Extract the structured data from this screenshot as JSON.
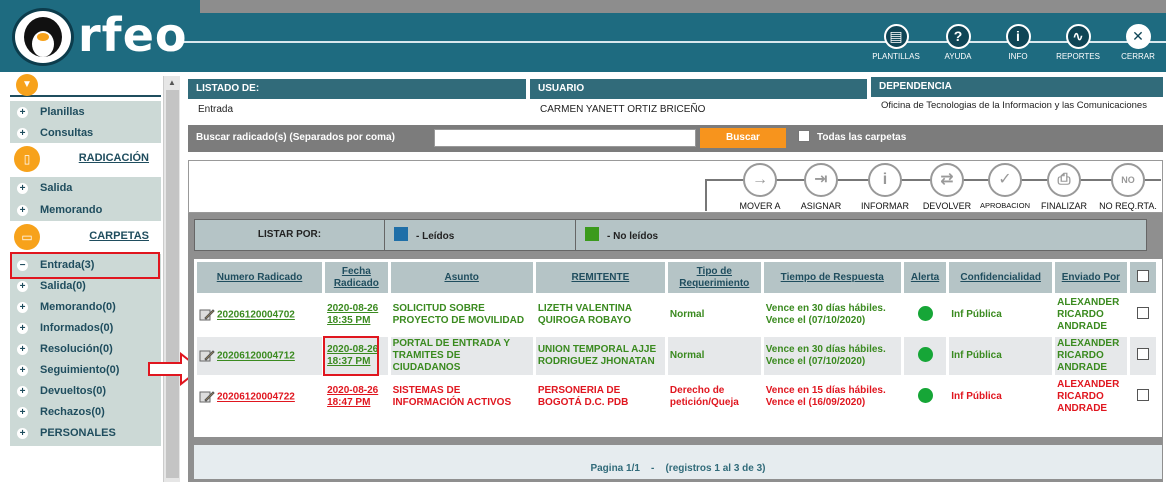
{
  "app": {
    "logo_text": "rfeo"
  },
  "topnav": [
    {
      "label": "PLANTILLAS",
      "icon": "template-icon"
    },
    {
      "label": "AYUDA",
      "icon": "help-icon"
    },
    {
      "label": "INFO",
      "icon": "info-icon"
    },
    {
      "label": "REPORTES",
      "icon": "reports-icon"
    },
    {
      "label": "CERRAR",
      "icon": "close-icon"
    }
  ],
  "sidebar": {
    "top_items": [
      "Planillas",
      "Consultas"
    ],
    "radicacion": {
      "title": "RADICACIÓN",
      "items": [
        "Salida",
        "Memorando"
      ]
    },
    "carpetas": {
      "title": "CARPETAS",
      "items": [
        "Entrada(3)",
        "Salida(0)",
        "Memorando(0)",
        "Informados(0)",
        "Resolución(0)",
        "Seguimiento(0)",
        "Devueltos(0)",
        "Rechazos(0)",
        "PERSONALES"
      ]
    }
  },
  "info": {
    "listado_label": "LISTADO DE:",
    "listado_value": "Entrada",
    "usuario_label": "USUARIO",
    "usuario_value": "CARMEN YANETT ORTIZ BRICEÑO",
    "dependencia_label": "DEPENDENCIA",
    "dependencia_value": "Oficina de Tecnologias de la Informacion y las Comunicaciones"
  },
  "search": {
    "label": "Buscar radicado(s) (Separados por coma)",
    "value": "",
    "button": "Buscar",
    "all_folders_label": "Todas las carpetas"
  },
  "actions": [
    {
      "label": "MOVER A",
      "icon": "arrow-right-icon"
    },
    {
      "label": "ASIGNAR",
      "icon": "assign-icon"
    },
    {
      "label": "INFORMAR",
      "icon": "info-icon"
    },
    {
      "label": "DEVOLVER",
      "icon": "return-icon"
    },
    {
      "label": "APROBACION",
      "icon": "approve-icon"
    },
    {
      "label": "FINALIZAR",
      "icon": "finish-icon"
    },
    {
      "label": "NO REQ.RTA.",
      "icon": "no-response-icon"
    }
  ],
  "listby": {
    "label": "LISTAR POR:",
    "read": "- Leídos",
    "unread": "- No leídos",
    "read_color": "#1f6fa8",
    "unread_color": "#3b9a1c"
  },
  "table": {
    "headers": [
      "Numero Radicado",
      "Fecha Radicado",
      "Asunto",
      "REMITENTE",
      "Tipo de Requerimiento",
      "Tiempo de Respuesta",
      "Alerta",
      "Confidencialidad",
      "Enviado Por"
    ],
    "rows": [
      {
        "numero": "20206120004702",
        "fecha": "2020-08-26 18:35 PM",
        "asunto": "SOLICITUD SOBRE PROYECTO DE MOVILIDAD",
        "remitente": "LIZETH VALENTINA QUIROGA ROBAYO",
        "tipo": "Normal",
        "tiempo": "Vence en 30 días hábiles. Vence el (07/10/2020)",
        "conf": "Inf Pública",
        "enviado": "ALEXANDER RICARDO ANDRADE"
      },
      {
        "numero": "20206120004712",
        "fecha": "2020-08-26 18:37 PM",
        "asunto": "PORTAL DE ENTRADA Y TRAMITES DE CIUDADANOS",
        "remitente": "UNION TEMPORAL AJJE RODRIGUEZ JHONATAN",
        "tipo": "Normal",
        "tiempo": "Vence en 30 días hábiles. Vence el (07/10/2020)",
        "conf": "Inf Pública",
        "enviado": "ALEXANDER RICARDO ANDRADE"
      },
      {
        "numero": "20206120004722",
        "fecha": "2020-08-26 18:47 PM",
        "asunto": "SISTEMAS DE INFORMACIÓN ACTIVOS",
        "remitente": "PERSONERIA DE BOGOTÁ D.C. PDB",
        "tipo": "Derecho de petición/Queja",
        "tiempo": "Vence en 15 días hábiles. Vence el (16/09/2020)",
        "conf": "Inf Pública",
        "enviado": "ALEXANDER RICARDO ANDRADE"
      }
    ]
  },
  "pager": {
    "text": "Pagina 1/1    -    (registros 1 al 3 de 3)"
  },
  "colors": {
    "header_bg": "#1e6b80",
    "accent": "#f7a21b",
    "alert_green": "#16a637"
  }
}
